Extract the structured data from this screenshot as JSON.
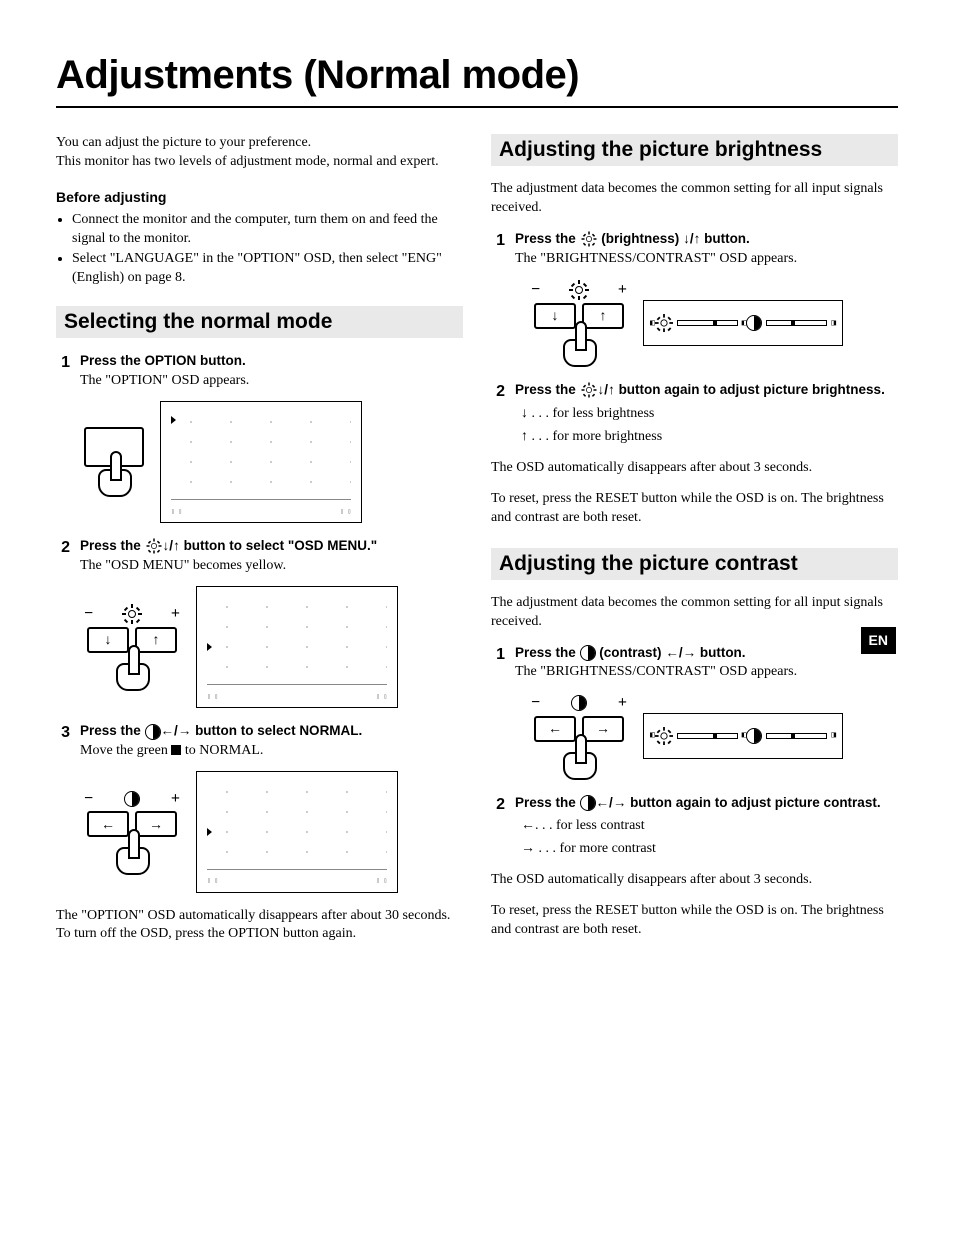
{
  "page_title": "Adjustments (Normal mode)",
  "lang_tab": "EN",
  "left": {
    "intro": "You can adjust the picture to your preference.\nThis monitor has two levels of adjustment mode, normal and expert.",
    "before_heading": "Before adjusting",
    "before_items": [
      "Connect the monitor and the computer, turn them on and feed the signal to the monitor.",
      "Select \"LANGUAGE\" in the \"OPTION\" OSD, then select \"ENG\" (English) on page 8."
    ],
    "section": "Selecting the normal mode",
    "steps": [
      {
        "n": "1",
        "title": "Press the OPTION button.",
        "desc": "The \"OPTION\" OSD appears."
      },
      {
        "n": "2",
        "title_a": "Press the ",
        "title_b": " button to select \"OSD MENU.\"",
        "desc": "The \"OSD MENU\" becomes yellow."
      },
      {
        "n": "3",
        "title_a": "Press the ",
        "title_b": " button to select NORMAL.",
        "desc_a": "Move the green ",
        "desc_b": " to NORMAL."
      }
    ],
    "closing": "The \"OPTION\" OSD automatically disappears after about 30 seconds. To turn off the OSD, press the OPTION button again."
  },
  "right": {
    "section_a": "Adjusting the picture brightness",
    "a_intro": "The adjustment data becomes the common setting for all input signals received.",
    "a_steps": [
      {
        "n": "1",
        "title_a": "Press  the ",
        "title_mid": " (brightness) ",
        "title_b": " button.",
        "desc": "The \"BRIGHTNESS/CONTRAST\" OSD appears."
      },
      {
        "n": "2",
        "title_a": "Press the ",
        "title_b": " button again to adjust picture brightness.",
        "less": " . . . for less brightness",
        "more": " . . . for more brightness"
      }
    ],
    "a_auto": "The OSD automatically disappears after about 3 seconds.",
    "a_reset": "To reset,  press the RESET button while the OSD is on. The brightness and contrast are both reset.",
    "section_b": "Adjusting the picture contrast",
    "b_intro": "The adjustment data becomes the common setting for all input signals received.",
    "b_steps": [
      {
        "n": "1",
        "title_a": "Press  the ",
        "title_mid": " (contrast) ",
        "title_b": " button.",
        "desc": "The \"BRIGHTNESS/CONTRAST\" OSD appears."
      },
      {
        "n": "2",
        "title_a": "Press the ",
        "title_b": " button again to adjust picture contrast.",
        "less": ". . . for less contrast",
        "more": " . . . for more contrast"
      }
    ],
    "b_auto": "The OSD automatically disappears after about 3 seconds.",
    "b_reset": "To reset,  press the RESET button while the OSD is on. The brightness and contrast are both reset."
  },
  "glyphs": {
    "down": "↓",
    "up": "↑",
    "left": "←",
    "right": "→",
    "slash": "/",
    "minus": "−",
    "plus": "+"
  }
}
